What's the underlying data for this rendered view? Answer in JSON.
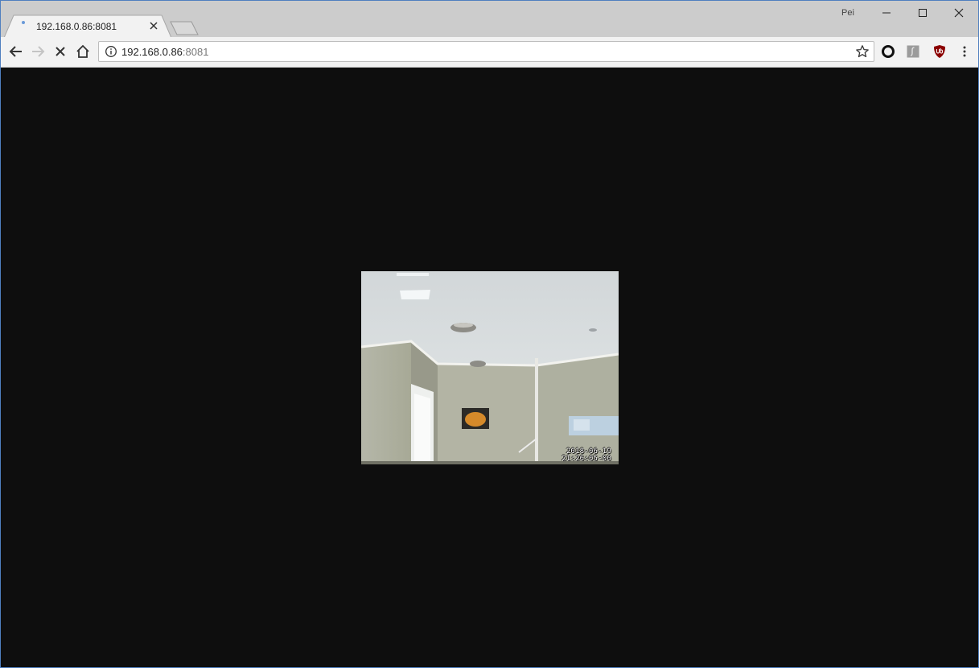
{
  "browser": {
    "tab": {
      "title": "192.168.0.86:8081"
    },
    "profile": {
      "name": "Pei"
    },
    "address": {
      "host": "192.168.0.86",
      "port": ":8081"
    }
  },
  "camera": {
    "timestamp_date": "2018-06-19",
    "timestamp_time": "21:26:05-00"
  },
  "icons": {
    "back": "arrow-left-icon",
    "forward": "arrow-right-icon",
    "stop": "close-icon",
    "home": "home-icon",
    "info": "info-icon",
    "bookmark": "star-icon",
    "menu": "kebab-menu-icon",
    "extensions": [
      "ring-extension-icon",
      "script-extension-icon",
      "ublock-shield-icon"
    ]
  },
  "colors": {
    "content_background": "#0e0e0e",
    "window_border": "#4f7fbf",
    "ublock_red": "#8b0000"
  }
}
